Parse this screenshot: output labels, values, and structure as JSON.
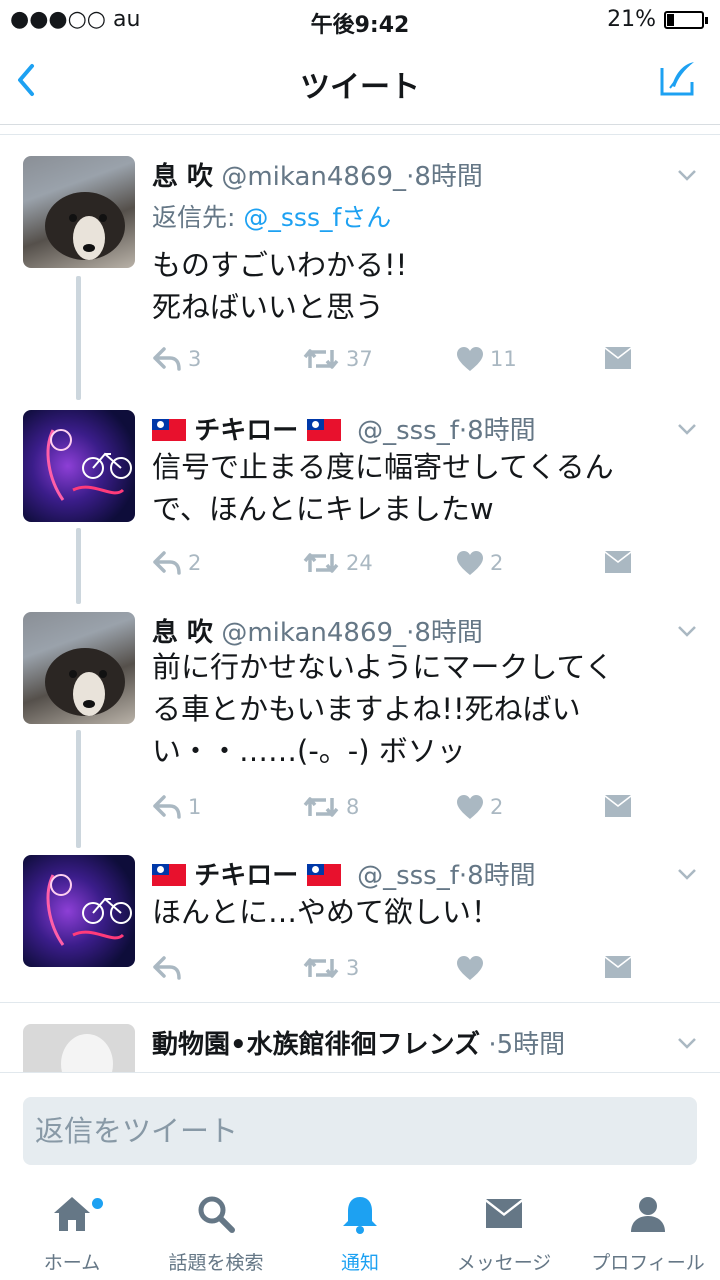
{
  "status": {
    "carrier": "●●●○○ au",
    "time": "午後9:42",
    "battery": "21%",
    "battery_level": 0.21
  },
  "nav": {
    "back": "‹",
    "title": "ツイート"
  },
  "tweets": [
    {
      "name": "息 吹",
      "handle": "@mikan4869_",
      "time": "8時間",
      "reply_prefix": "返信先:",
      "reply_to": "@_sss_fさん",
      "text1": "ものすごいわかる!!",
      "text2": "死ねばいいと思う",
      "replies": "3",
      "retweets": "37",
      "likes": "11"
    },
    {
      "name": "チキロー",
      "handle": "@_sss_f",
      "time": "8時間",
      "text1": "信号で止まる度に幅寄せしてくるん",
      "text2": "で、ほんとにキレましたw",
      "replies": "2",
      "retweets": "24",
      "likes": "2"
    },
    {
      "name": "息 吹",
      "handle": "@mikan4869_",
      "time": "8時間",
      "text1": "前に行かせないようにマークしてく",
      "text2": "る車とかもいますよね!!死ねばい",
      "text3": "い・・……(-。-) ボソッ",
      "replies": "1",
      "retweets": "8",
      "likes": "2"
    },
    {
      "name": "チキロー",
      "handle": "@_sss_f",
      "time": "8時間",
      "text1": "ほんとに…やめて欲しい！",
      "retweets": "3"
    },
    {
      "name": "動物園•水族館徘徊フレンズ",
      "time": "5時間"
    }
  ],
  "composer": {
    "placeholder": "返信をツイート"
  },
  "tabs": [
    {
      "label": "ホーム",
      "icon": "home-icon"
    },
    {
      "label": "話題を検索",
      "icon": "search-icon"
    },
    {
      "label": "通知",
      "icon": "bell-icon"
    },
    {
      "label": "メッセージ",
      "icon": "envelope-icon"
    },
    {
      "label": "プロフィール",
      "icon": "person-icon"
    }
  ],
  "colors": {
    "accent": "#1da1f2",
    "muted": "#657786",
    "icon_gray": "#aab8c2"
  }
}
